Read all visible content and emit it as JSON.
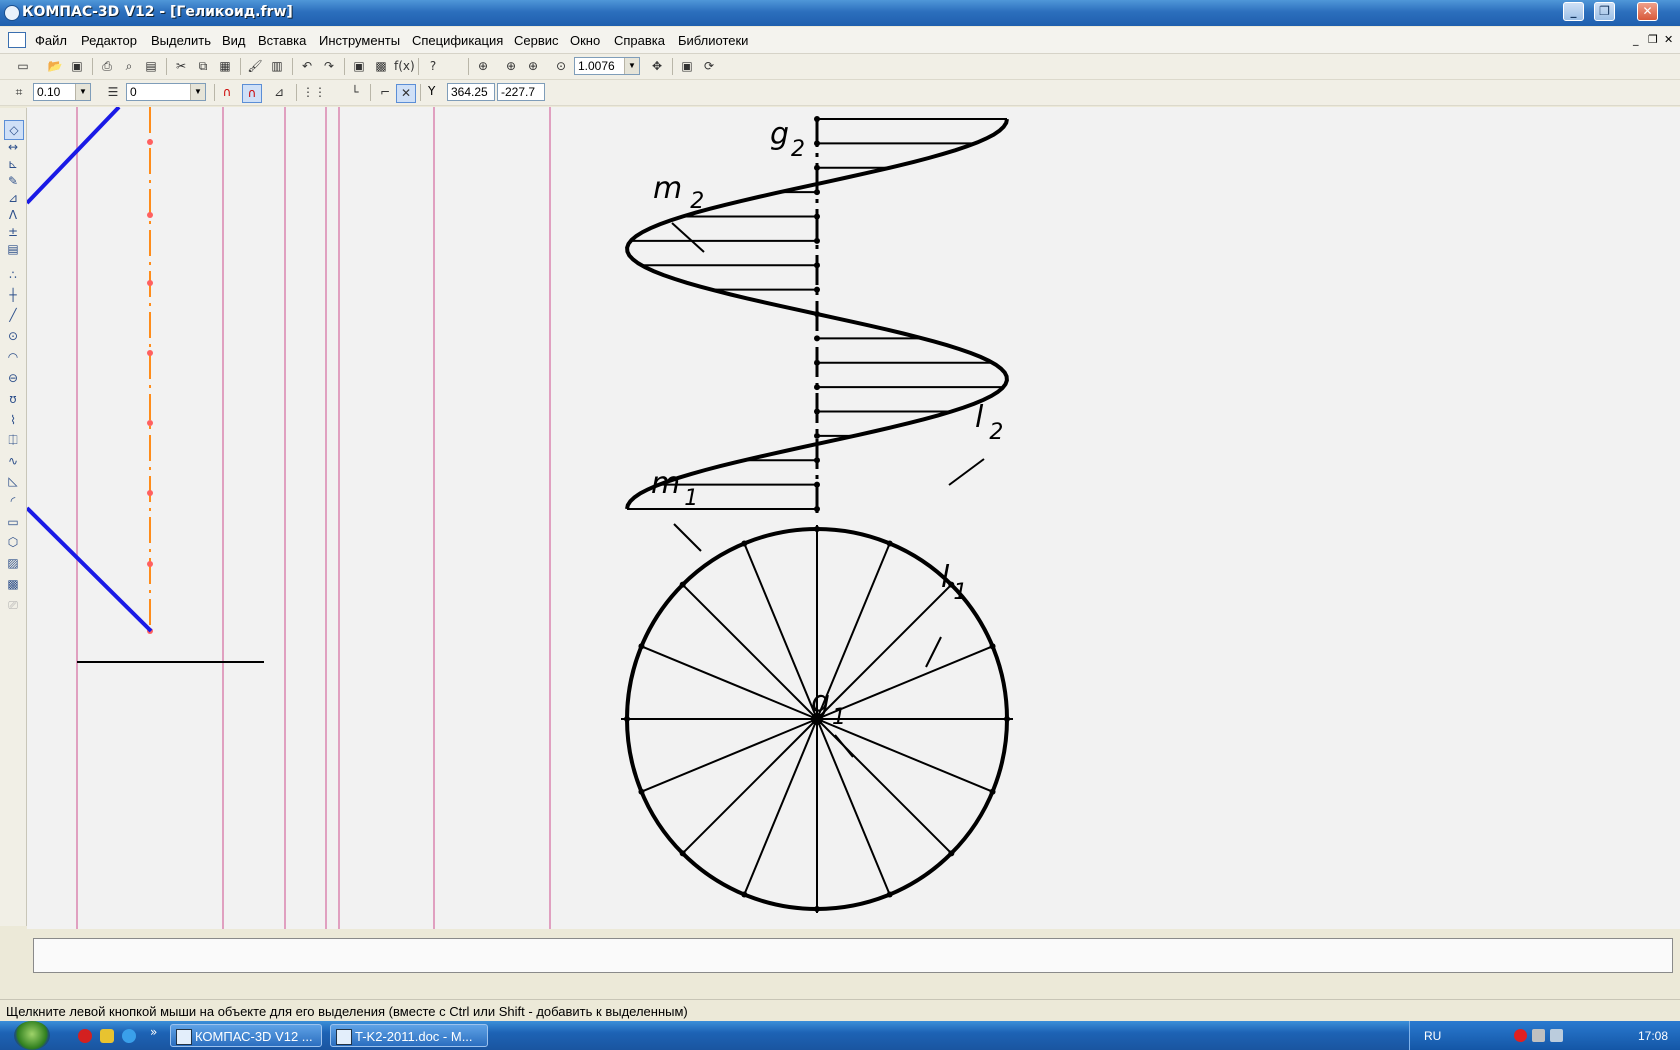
{
  "window": {
    "title": "КОМПАС-3D V12 - [Геликоид.frw]",
    "min_label": "_",
    "max_label": "❐",
    "close_label": "✕"
  },
  "menu": {
    "items": [
      "Файл",
      "Редактор",
      "Выделить",
      "Вид",
      "Вставка",
      "Инструменты",
      "Спецификация",
      "Сервис",
      "Окно",
      "Справка",
      "Библиотеки"
    ],
    "mdi_min": "_",
    "mdi_restore": "❐",
    "mdi_close": "✕"
  },
  "toolbar": {
    "zoom_value": "1.0076"
  },
  "toolbar2": {
    "step_value": "0.10",
    "layer_value": "0",
    "coord_x": "364.25",
    "coord_y": "-227.7",
    "coord_label": "Y"
  },
  "drawing": {
    "labels": {
      "g2": {
        "main": "g",
        "sub": "2"
      },
      "m2": {
        "main": "m",
        "sub": "2"
      },
      "l2": {
        "main": "l",
        "sub": "2"
      },
      "m1": {
        "main": "m",
        "sub": "1"
      },
      "l1": {
        "main": "l",
        "sub": "1"
      },
      "g1": {
        "main": "g",
        "sub": "1"
      }
    },
    "colors": {
      "pink_lines": "#e0a0c0",
      "orange_axis": "#ff8c1a",
      "blue_lines": "#1a1ae6",
      "ink": "#000000"
    }
  },
  "status": {
    "message": "Щелкните левой кнопкой мыши на объекте для его выделения (вместе с Ctrl или Shift - добавить к выделенным)"
  },
  "taskbar": {
    "tasks": [
      "КОМПАС-3D V12 ...",
      "T-K2-2011.doc - M..."
    ],
    "more": "»",
    "lang": "RU",
    "time": "17:08"
  }
}
